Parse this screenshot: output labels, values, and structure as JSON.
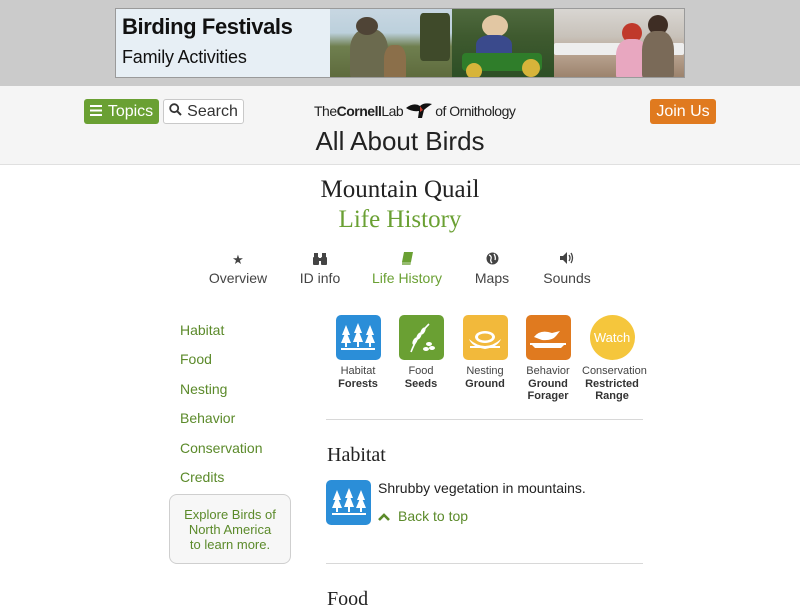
{
  "banner": {
    "title": "Birding Festivals",
    "subtitle": "Family Activities"
  },
  "header": {
    "topics_label": "Topics",
    "search_label": "Search",
    "logo_text_the": "The",
    "logo_text_cornell": "Cornell",
    "logo_text_lab": "Lab",
    "logo_text_of": "of Ornithology",
    "join_label": "Join Us",
    "site_title": "All About Birds"
  },
  "species": {
    "name": "Mountain Quail",
    "section": "Life History"
  },
  "tabs": [
    {
      "label": "Overview",
      "icon": "star-icon"
    },
    {
      "label": "ID info",
      "icon": "binoculars-icon"
    },
    {
      "label": "Life History",
      "icon": "book-icon",
      "active": true
    },
    {
      "label": "Maps",
      "icon": "globe-icon"
    },
    {
      "label": "Sounds",
      "icon": "speaker-icon"
    }
  ],
  "sidebar": {
    "items": [
      "Habitat",
      "Food",
      "Nesting",
      "Behavior",
      "Conservation",
      "Credits"
    ],
    "explore_line1": "Explore Birds of",
    "explore_line2": "North America",
    "explore_line3": "to learn more."
  },
  "quicklinks": [
    {
      "label": "Habitat",
      "value": "Forests",
      "icon": "forest-icon",
      "color": "#2b8ed8"
    },
    {
      "label": "Food",
      "value": "Seeds",
      "icon": "seeds-icon",
      "color": "#6aa033"
    },
    {
      "label": "Nesting",
      "value": "Ground",
      "icon": "nest-icon",
      "color": "#f2b93b"
    },
    {
      "label": "Behavior",
      "value1": "Ground",
      "value2": "Forager",
      "icon": "ground-forager-icon",
      "color": "#e07a1f"
    },
    {
      "label": "Conservation",
      "value1": "Restricted",
      "value2": "Range",
      "badge": "Watch",
      "color": "#f5c63c"
    }
  ],
  "habitat": {
    "heading": "Habitat",
    "text": "Shrubby vegetation in mountains.",
    "back_to_top": "Back to top"
  },
  "food": {
    "heading": "Food"
  },
  "colors": {
    "green": "#6aa033",
    "orange": "#e07a1f",
    "blue": "#2b8ed8",
    "yellow": "#f2b93b"
  }
}
